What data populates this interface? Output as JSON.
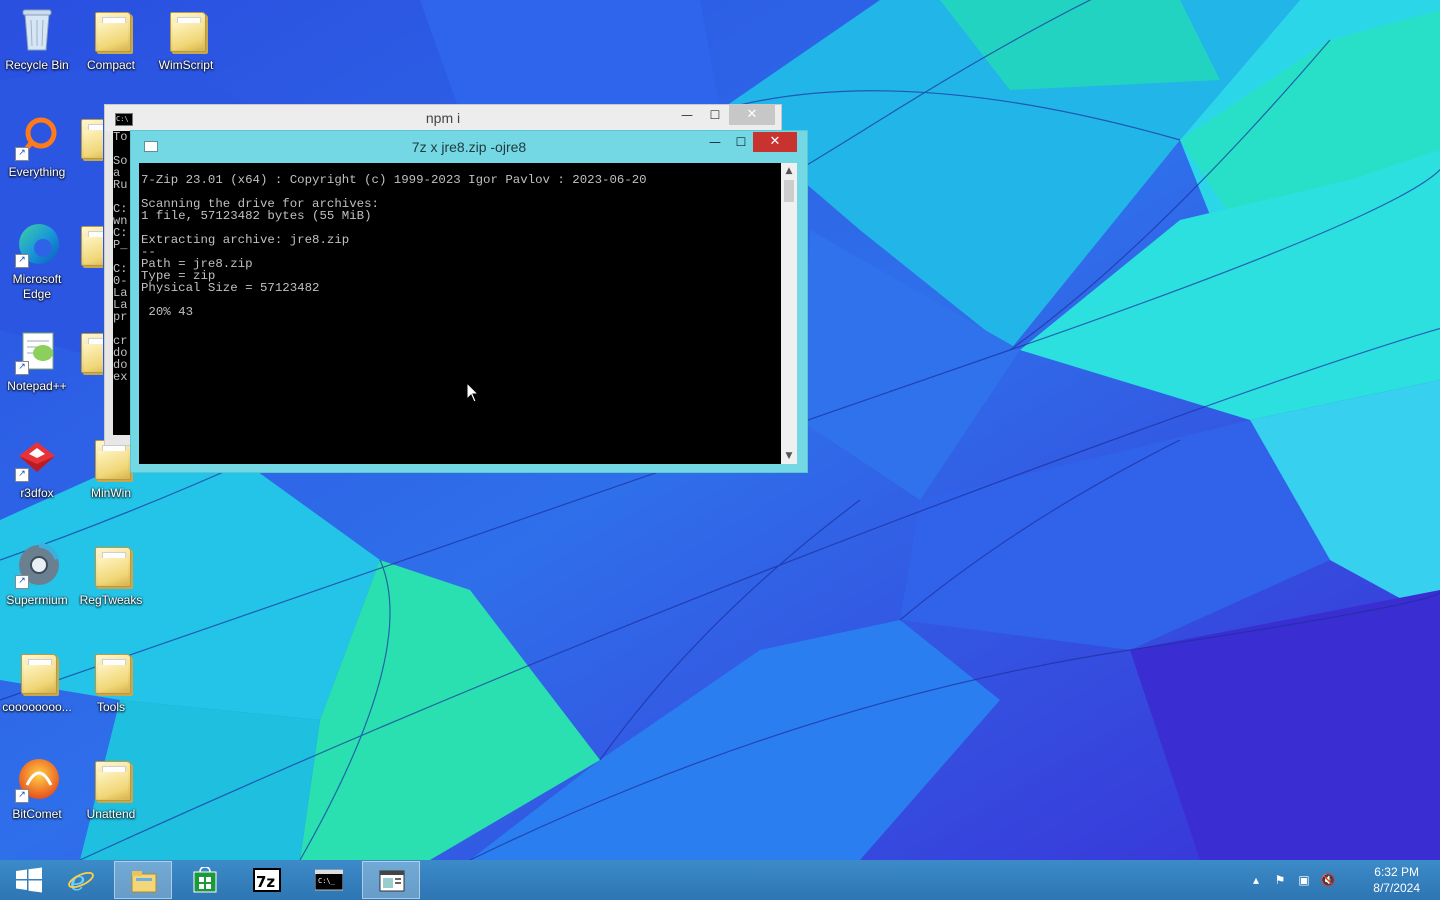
{
  "desktop": {
    "icons": [
      {
        "label": "Recycle Bin"
      },
      {
        "label": "Compact"
      },
      {
        "label": "WimScript"
      },
      {
        "label": "Everything"
      },
      {
        "label": "Microsoft Edge"
      },
      {
        "label": "Notepad++"
      },
      {
        "label": "r3dfox"
      },
      {
        "label": "MinWin"
      },
      {
        "label": "Supermium"
      },
      {
        "label": "RegTweaks"
      },
      {
        "label": "coooooooo..."
      },
      {
        "label": "Tools"
      },
      {
        "label": "BitComet"
      },
      {
        "label": "Unattend"
      }
    ]
  },
  "windows": {
    "npm": {
      "title": "npm i",
      "console_fragment": "To\n\nSo\na\nRu\n\nC:\nwn\nC:\nP_\n\nC:\n0-\nLa\nLa\npr\n\ncr\ndo\ndo\nex"
    },
    "sevenzip": {
      "title": "7z  x jre8.zip -ojre8",
      "console_text": "7-Zip 23.01 (x64) : Copyright (c) 1999-2023 Igor Pavlov : 2023-06-20\n\nScanning the drive for archives:\n1 file, 57123482 bytes (55 MiB)\n\nExtracting archive: jre8.zip\n--\nPath = jre8.zip\nType = zip\nPhysical Size = 57123482\n\n 20% 43"
    }
  },
  "window_controls": {
    "minimize": "—",
    "maximize": "☐",
    "close": "✕"
  },
  "taskbar": {
    "buttons": [
      {
        "name": "start"
      },
      {
        "name": "internet-explorer"
      },
      {
        "name": "file-explorer"
      },
      {
        "name": "store"
      },
      {
        "name": "7zip"
      },
      {
        "name": "command-prompt"
      },
      {
        "name": "window-preview"
      }
    ],
    "clock": {
      "time": "6:32 PM",
      "date": "8/7/2024"
    }
  },
  "colors": {
    "taskbar": "#2e75b3",
    "window_7z_frame": "#73d8e3",
    "close_active": "#c8322f"
  }
}
